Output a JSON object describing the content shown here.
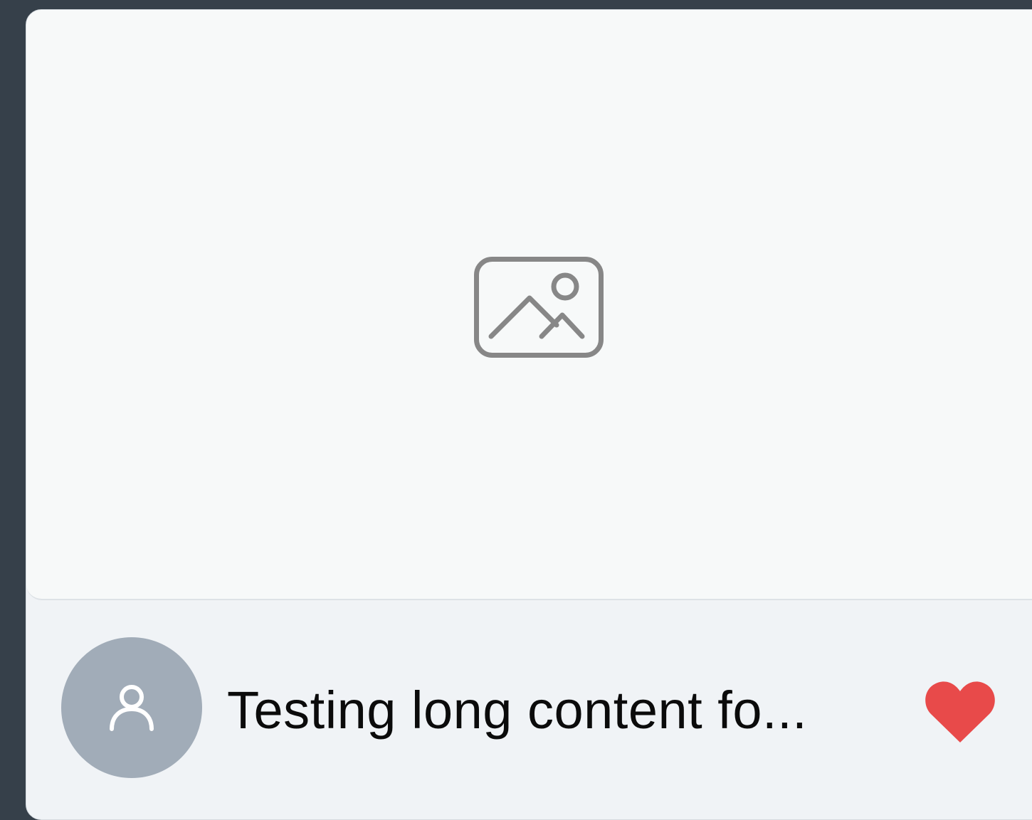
{
  "card": {
    "image_placeholder_icon": "image-placeholder-icon",
    "avatar_icon": "user-icon",
    "caption": "Testing long content fo...",
    "like_icon": "heart-icon",
    "like_color": "#e84a4a"
  }
}
